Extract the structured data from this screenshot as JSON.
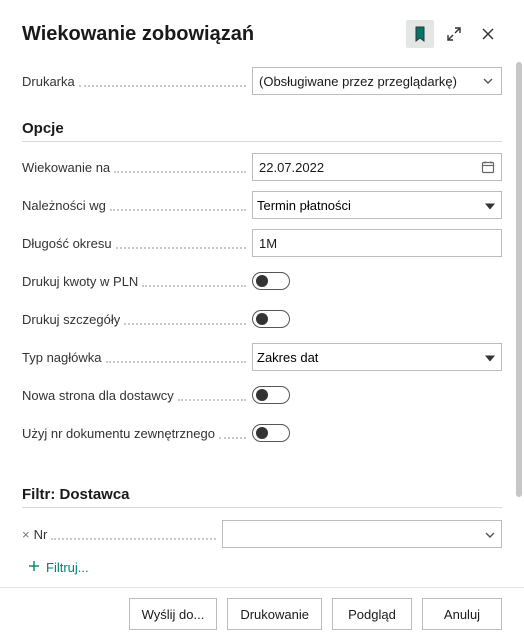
{
  "header": {
    "title": "Wiekowanie zobowiązań"
  },
  "printer": {
    "label": "Drukarka",
    "value": "(Obsługiwane przez przeglądarkę)"
  },
  "sections": {
    "options": "Opcje",
    "filter": "Filtr: Dostawca"
  },
  "options": {
    "aging_on": {
      "label": "Wiekowanie na",
      "value": "22.07.2022"
    },
    "aging_by": {
      "label": "Należności wg",
      "value": "Termin płatności"
    },
    "period_length": {
      "label": "Długość okresu",
      "value": "1M"
    },
    "print_pln": {
      "label": "Drukuj kwoty w PLN"
    },
    "print_details": {
      "label": "Drukuj szczegóły"
    },
    "heading_type": {
      "label": "Typ nagłówka",
      "value": "Zakres dat"
    },
    "new_page": {
      "label": "Nowa strona dla dostawcy"
    },
    "use_ext_doc": {
      "label": "Użyj nr dokumentu zewnętrznego"
    }
  },
  "filter": {
    "no_label": "Nr",
    "add_label": "Filtruj..."
  },
  "footer": {
    "send": "Wyślij do...",
    "print": "Drukowanie",
    "preview": "Podgląd",
    "cancel": "Anuluj"
  }
}
